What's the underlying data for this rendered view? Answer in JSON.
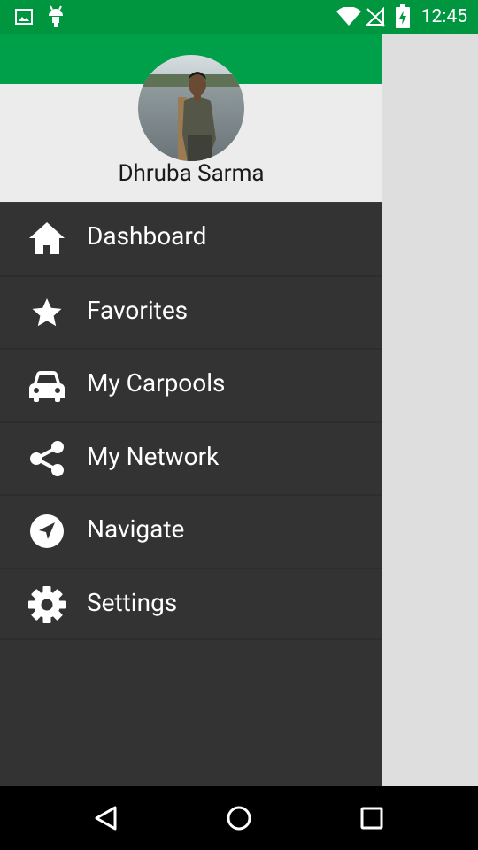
{
  "status_bar": {
    "time": "12:45",
    "left_icons": [
      "image-icon",
      "android-icon"
    ],
    "right_icons": [
      "wifi-icon",
      "no-signal-icon",
      "battery-charging-icon"
    ]
  },
  "drawer": {
    "user_name": "Dhruba Sarma",
    "menu": [
      {
        "label": "Dashboard",
        "icon": "home-icon"
      },
      {
        "label": "Favorites",
        "icon": "star-icon"
      },
      {
        "label": "My Carpools",
        "icon": "car-icon"
      },
      {
        "label": "My Network",
        "icon": "share-icon"
      },
      {
        "label": "Navigate",
        "icon": "navigation-icon"
      },
      {
        "label": "Settings",
        "icon": "gear-icon"
      }
    ]
  },
  "nav_bar": {
    "buttons": [
      "back-button",
      "home-button",
      "recents-button"
    ]
  },
  "colors": {
    "status_bar": "#00963f",
    "header_band": "#00a04b",
    "drawer_bg": "#333333",
    "header_bg": "#ececec",
    "scrim": "#dedede"
  }
}
